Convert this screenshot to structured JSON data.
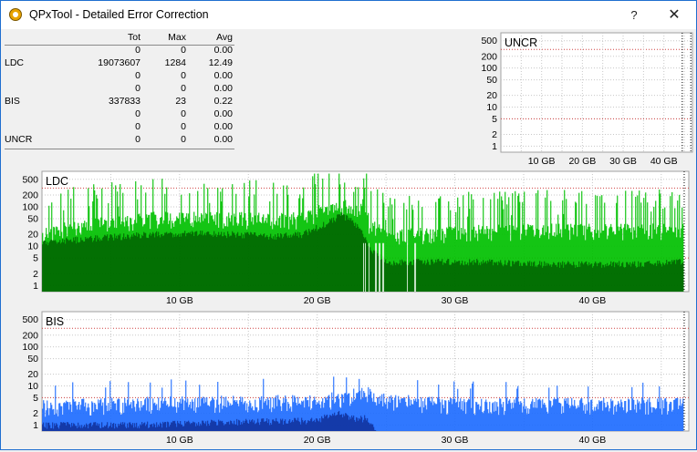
{
  "window": {
    "title": "QPxTool - Detailed Error Correction",
    "help_glyph": "?",
    "close_glyph": "✕"
  },
  "stats": {
    "headers": [
      "Tot",
      "Max",
      "Avg"
    ],
    "rows": [
      {
        "label": "",
        "tot": "0",
        "max": "0",
        "avg": "0.00"
      },
      {
        "label": "LDC",
        "tot": "19073607",
        "max": "1284",
        "avg": "12.49"
      },
      {
        "label": "",
        "tot": "0",
        "max": "0",
        "avg": "0.00"
      },
      {
        "label": "",
        "tot": "0",
        "max": "0",
        "avg": "0.00"
      },
      {
        "label": "BIS",
        "tot": "337833",
        "max": "23",
        "avg": "0.22"
      },
      {
        "label": "",
        "tot": "0",
        "max": "0",
        "avg": "0.00"
      },
      {
        "label": "",
        "tot": "0",
        "max": "0",
        "avg": "0.00"
      },
      {
        "label": "UNCR",
        "tot": "0",
        "max": "0",
        "avg": "0.00"
      }
    ]
  },
  "chart_data": [
    {
      "id": "uncr",
      "type": "area",
      "title": "UNCR",
      "y_scale": "log",
      "y_ticks": [
        "500",
        "200",
        "100",
        "50",
        "20",
        "10",
        "5",
        "2",
        "1"
      ],
      "x_ticks": [
        "10 GB",
        "20 GB",
        "30 GB",
        "40 GB"
      ],
      "xlim": [
        0,
        47
      ],
      "series": [
        {
          "values": [],
          "color": "#00b000"
        }
      ]
    },
    {
      "id": "ldc",
      "type": "area",
      "title": "LDC",
      "y_scale": "log",
      "y_ticks": [
        "500",
        "200",
        "100",
        "50",
        "20",
        "10",
        "5",
        "2",
        "1"
      ],
      "x_ticks": [
        "10 GB",
        "20 GB",
        "30 GB",
        "40 GB"
      ],
      "xlim": [
        0,
        47
      ],
      "colors": {
        "max": "#00c000",
        "avg": "#006000"
      },
      "series": [
        {
          "x": [
            0,
            2,
            5,
            8,
            11,
            14,
            17,
            19,
            20.5,
            21.8,
            23,
            23.4,
            23.8,
            25,
            28,
            32,
            36,
            40,
            44,
            46.6
          ],
          "values": [
            22,
            35,
            48,
            60,
            62,
            60,
            55,
            60,
            100,
            140,
            90,
            150,
            40,
            22,
            25,
            28,
            30,
            30,
            30,
            32
          ]
        },
        {
          "x": [
            0,
            2,
            5,
            8,
            11,
            14,
            17,
            19,
            20.5,
            21.8,
            23,
            23.4,
            23.8,
            25,
            28,
            32,
            36,
            40,
            44,
            46.6
          ],
          "values": [
            12,
            14,
            17,
            20,
            21,
            20,
            18,
            20,
            35,
            60,
            30,
            20,
            8,
            4,
            4,
            4,
            3.5,
            3.5,
            3.5,
            4
          ]
        }
      ]
    },
    {
      "id": "bis",
      "type": "area",
      "title": "BIS",
      "y_scale": "log",
      "y_ticks": [
        "500",
        "200",
        "100",
        "50",
        "20",
        "10",
        "5",
        "2",
        "1"
      ],
      "x_ticks": [
        "10 GB",
        "20 GB",
        "30 GB",
        "40 GB"
      ],
      "xlim": [
        0,
        47
      ],
      "colors": {
        "max": "#1e6cff",
        "avg": "#102f9a"
      },
      "series": [
        {
          "x": [
            0,
            5,
            10,
            15,
            20,
            22,
            23.5,
            25,
            30,
            35,
            40,
            46.6
          ],
          "values": [
            3.5,
            4,
            4.5,
            4.5,
            5,
            6,
            8,
            5,
            4,
            4,
            4,
            4
          ]
        },
        {
          "x": [
            0,
            7,
            14,
            20,
            21.5,
            23,
            23.5,
            25,
            30,
            46.6
          ],
          "values": [
            1,
            1,
            1.2,
            1.3,
            2,
            1.4,
            1.5,
            0,
            0,
            0
          ]
        }
      ]
    }
  ]
}
